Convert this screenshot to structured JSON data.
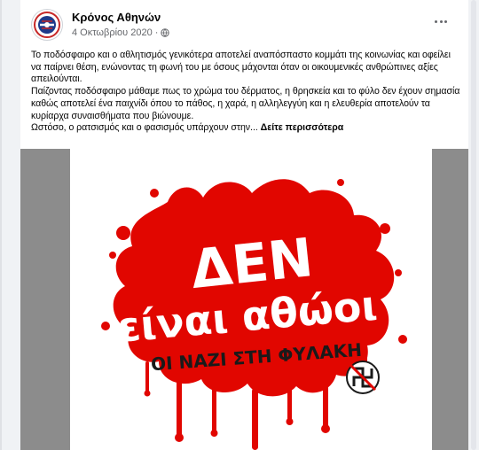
{
  "post": {
    "author": "Κρόνος Αθηνών",
    "date": "4 Οκτωβρίου 2020",
    "separator": "·",
    "paragraphs": [
      "Το ποδόσφαιρο και ο αθλητισμός γενικότερα αποτελεί αναπόσπαστο κομμάτι της κοινωνίας και οφείλει να παίρνει θέση, ενώνοντας τη φωνή του με όσους μάχονται όταν οι οικουμενικές ανθρώπινες αξίες απειλούνται.",
      "Παίζοντας ποδόσφαιρο μάθαμε πως το χρώμα του δέρματος, η θρησκεία και το φύλο δεν έχουν σημασία καθώς αποτελεί ένα παιχνίδι όπου το πάθος, η χαρά, η αλληλεγγύη και η ελευθερία αποτελούν τα κυρίαρχα συναισθήματα που βιώνουμε."
    ],
    "truncated_line": "Ωστόσο, ο ρατσισμός και ο φασισμός υπάρχουν στην...",
    "see_more": "Δείτε περισσότερα"
  },
  "poster": {
    "line1": "ΔΕΝ",
    "line2": "είναι αθώοι",
    "line3": "ΟΙ ΝΑΖΙ ΣΤΗ ΦΥΛΑΚΗ",
    "splash_color": "#e10600",
    "stamp_color": "#1a1a1a"
  },
  "icons": {
    "avatar": "club-logo-icon",
    "privacy": "globe-icon",
    "menu": "more-options-icon"
  }
}
